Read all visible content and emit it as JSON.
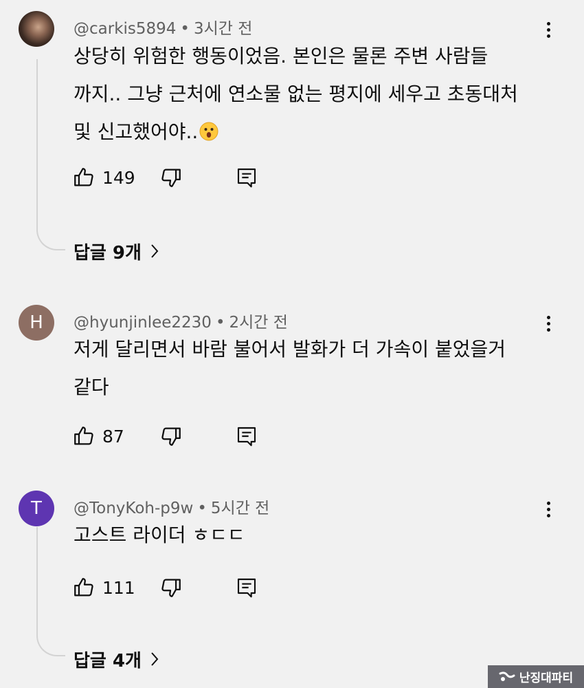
{
  "comments": [
    {
      "author": "@carkis5894",
      "time": "3시간 전",
      "lines": [
        "상당히 위험한 행동이었음. 본인은 물론 주변 사람들",
        "까지.. 그냥 근처에 연소물 없는 평지에 세우고 초동대처",
        "및 신고했어야.."
      ],
      "emoji": "hushed-face",
      "likes": "149",
      "replies_label": "답글 9개"
    },
    {
      "author": "@hyunjinlee2230",
      "time": "2시간 전",
      "avatar_letter": "H",
      "avatar_color": "#8d6e63",
      "lines": [
        "저게 달리면서 바람 불어서 발화가 더 가속이  붙었을거",
        "같다"
      ],
      "likes": "87"
    },
    {
      "author": "@TonyKoh-p9w",
      "time": "5시간 전",
      "avatar_letter": "T",
      "avatar_color": "#5e35b1",
      "lines": [
        "고스트 라이더 ㅎㄷㄷ"
      ],
      "likes": "111",
      "replies_label": "답글 4개"
    }
  ],
  "meta_separator": "•",
  "watermark": "난징대파티",
  "icons": {
    "like": "thumbs-up-icon",
    "dislike": "thumbs-down-icon",
    "reply": "comment-icon",
    "more": "more-vertical-icon",
    "expand": "chevron-right-icon"
  }
}
